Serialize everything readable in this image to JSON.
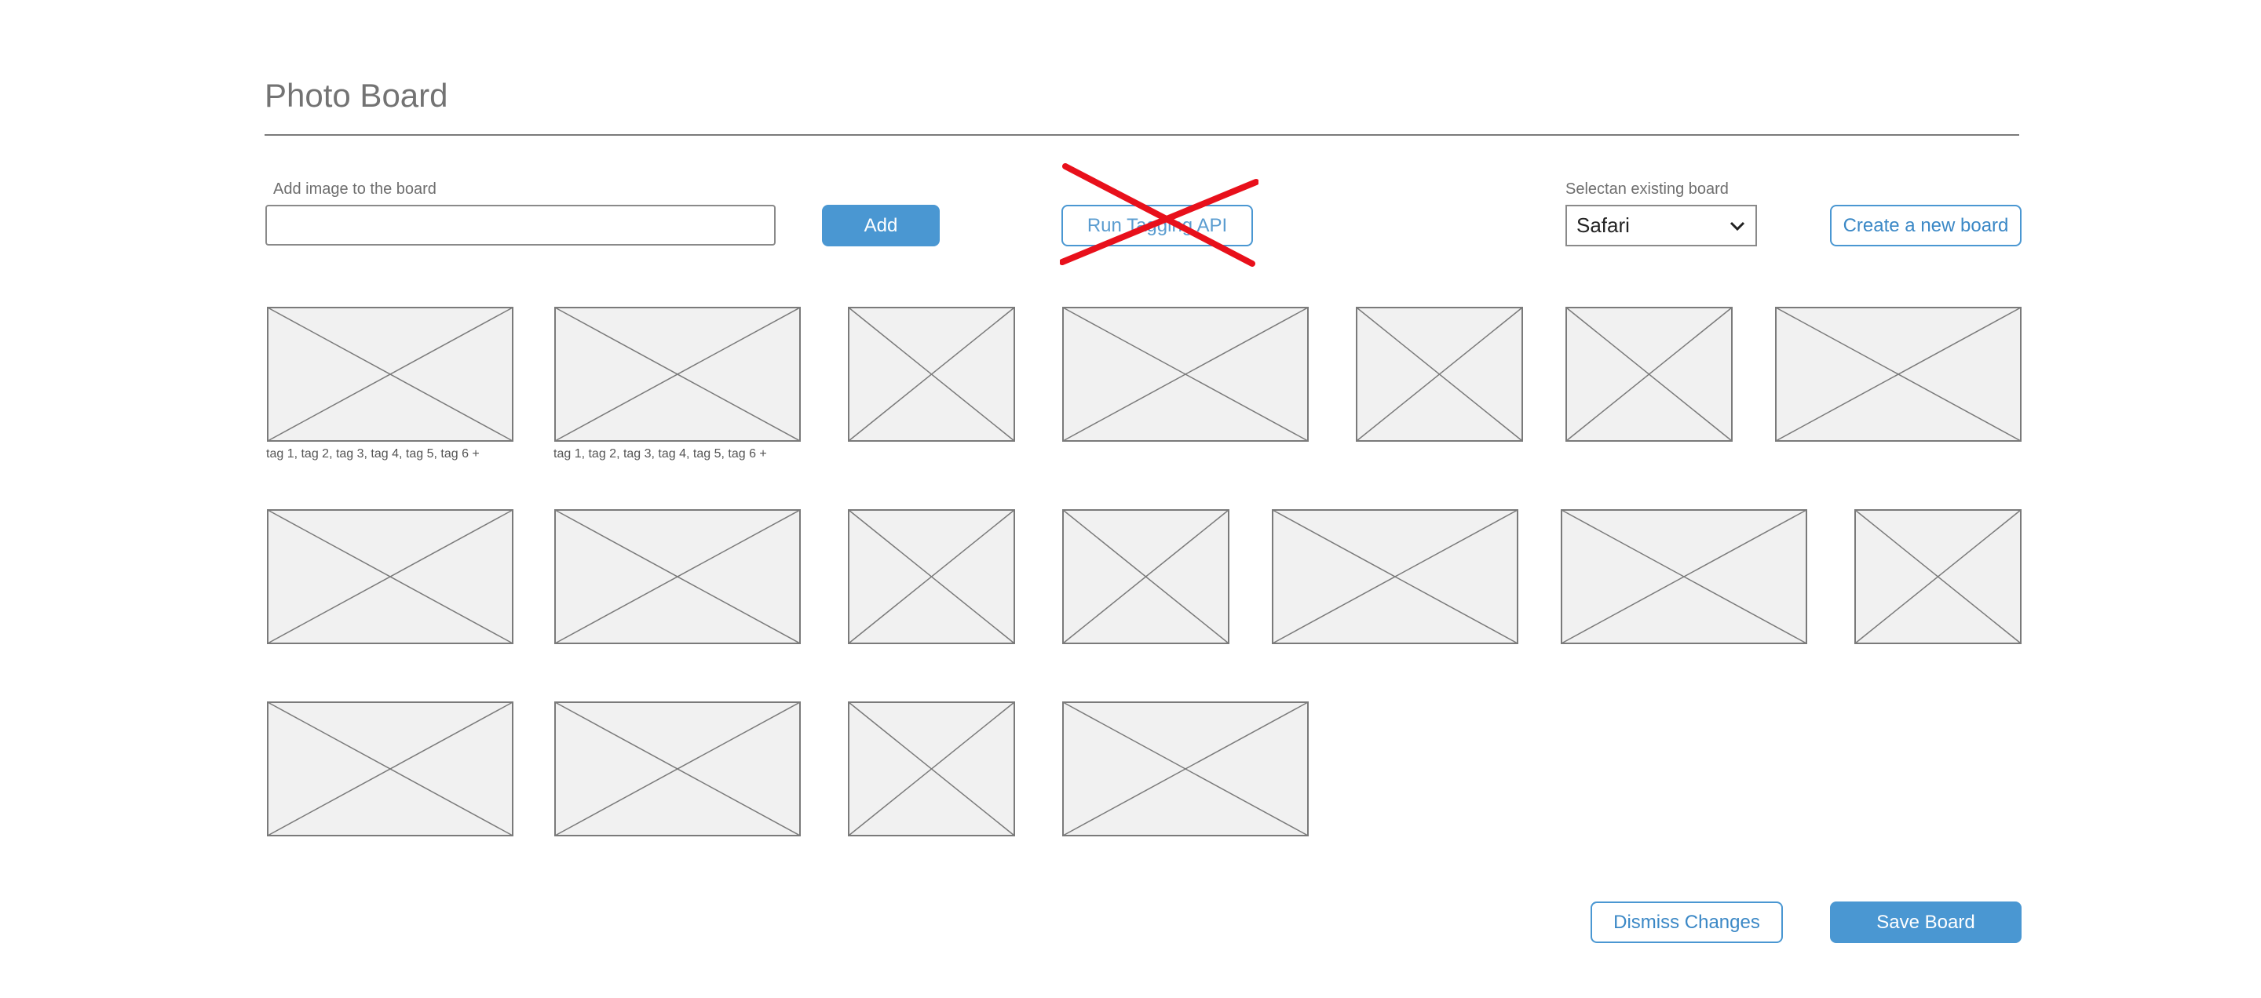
{
  "page": {
    "title": "Photo Board"
  },
  "add_image": {
    "label": "Add image to the board",
    "input_value": "",
    "add_button": "Add"
  },
  "tagging": {
    "button_label": "Run Tagging API",
    "crossed_out": true,
    "cross_color": "#e8101b"
  },
  "board_select": {
    "label": "Selectan existing board",
    "selected": "Safari",
    "create_button": "Create a new board"
  },
  "images": [
    {
      "tags": "tag 1, tag 2, tag 3, tag 4, tag 5, tag 6 +"
    },
    {
      "tags": "tag 1, tag 2, tag 3, tag 4, tag 5, tag 6 +"
    },
    {
      "tags": ""
    },
    {
      "tags": ""
    },
    {
      "tags": ""
    },
    {
      "tags": ""
    },
    {
      "tags": ""
    },
    {
      "tags": ""
    },
    {
      "tags": ""
    },
    {
      "tags": ""
    },
    {
      "tags": ""
    },
    {
      "tags": ""
    },
    {
      "tags": ""
    },
    {
      "tags": ""
    },
    {
      "tags": ""
    },
    {
      "tags": ""
    },
    {
      "tags": ""
    },
    {
      "tags": ""
    }
  ],
  "footer": {
    "dismiss_button": "Dismiss Changes",
    "save_button": "Save Board"
  },
  "colors": {
    "accent": "#4a97d2",
    "placeholder_fill": "#f1f1f1",
    "placeholder_stroke": "#7a7a7a"
  }
}
